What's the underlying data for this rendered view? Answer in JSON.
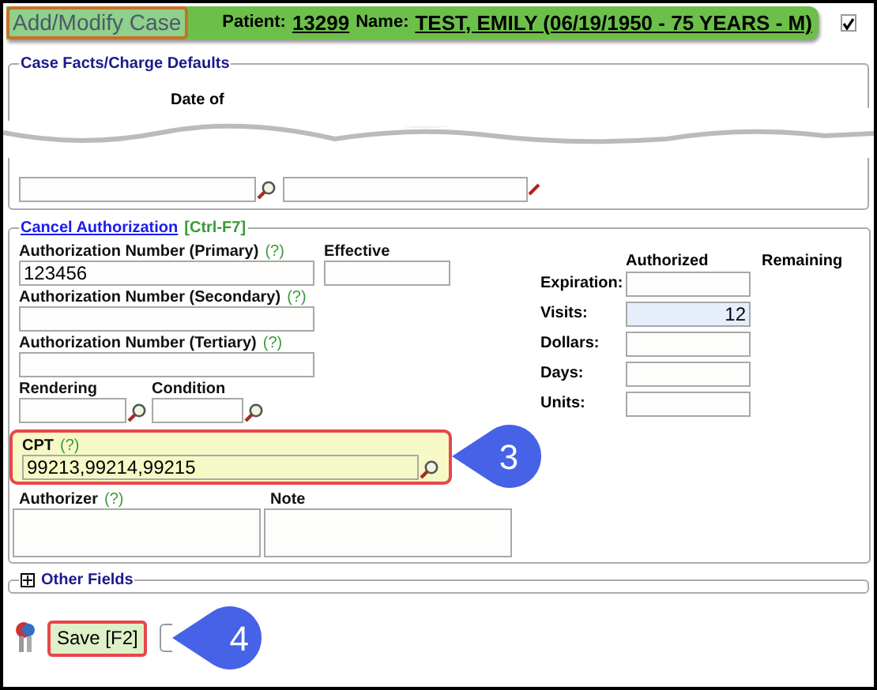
{
  "header": {
    "title": "Add/Modify Case",
    "patient_label": "Patient:",
    "patient_id": "13299",
    "name_label": "Name:",
    "name": "TEST, EMILY (06/19/1950 - 75 YEARS - M)",
    "checked": true
  },
  "case_facts": {
    "legend": "Case Facts/Charge Defaults",
    "partial_label": "Date of"
  },
  "authorization": {
    "link": "Cancel Authorization",
    "shortcut": "[Ctrl-F7]",
    "number_fields": [
      {
        "label": "Authorization Number (Primary)",
        "help": "(?)",
        "value": "123456"
      },
      {
        "label": "Authorization Number (Secondary)",
        "help": "(?)"
      },
      {
        "label": "Authorization Number (Tertiary)",
        "help": "(?)"
      }
    ],
    "effective": {
      "label": "Effective"
    },
    "lookups": [
      {
        "label": "Rendering"
      },
      {
        "label": "Condition"
      }
    ],
    "cpt": {
      "label": "CPT",
      "help": "(?)",
      "value": "99213,99214,99215",
      "highlighted": true,
      "callout": "3"
    },
    "limits": {
      "columns": [
        "Authorized",
        "Remaining"
      ],
      "rows": [
        {
          "label": "Expiration:",
          "highlighted": false
        },
        {
          "label": "Visits:",
          "value": "12",
          "highlighted": true
        },
        {
          "label": "Dollars:",
          "highlighted": false
        },
        {
          "label": "Days:",
          "highlighted": false
        },
        {
          "label": "Units:",
          "highlighted": false
        }
      ]
    },
    "notes": [
      {
        "label": "Authorizer",
        "help": "(?)"
      },
      {
        "label": "Note"
      }
    ]
  },
  "other_fields": {
    "label": "Other Fields",
    "expanded": false
  },
  "save_button": {
    "label": "Save [F2]",
    "highlighted": true,
    "callout": "4"
  }
}
